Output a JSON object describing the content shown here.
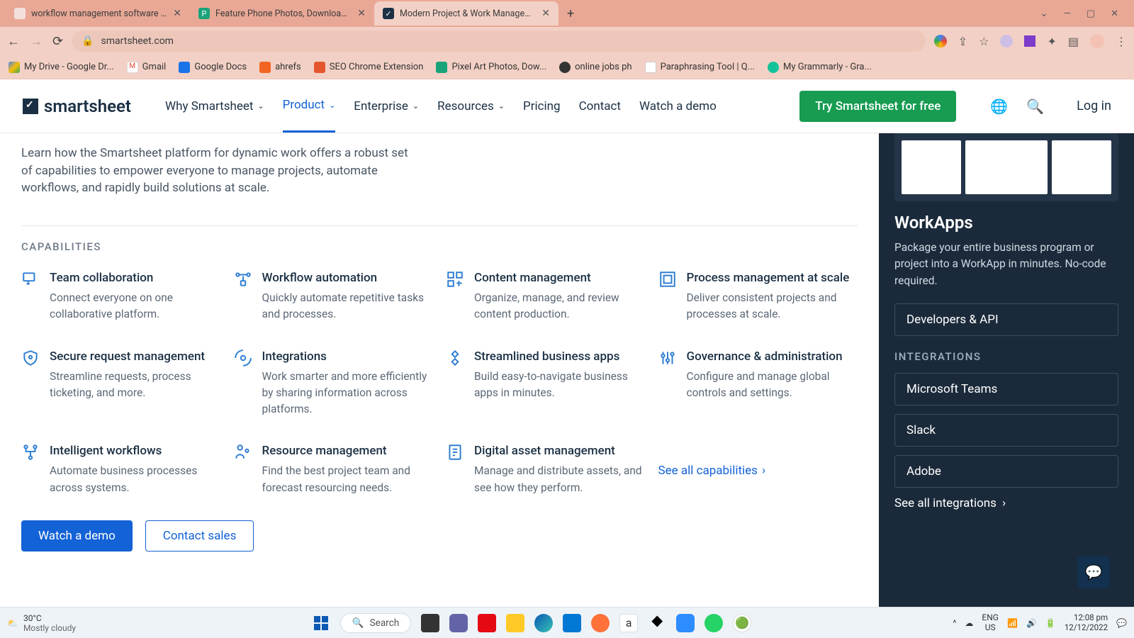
{
  "tabs": [
    {
      "title": "workflow management software - C",
      "active": false,
      "fav": "#dca9a0"
    },
    {
      "title": "Feature Phone Photos, Download Fr",
      "active": false,
      "fav": "#1aa37a"
    },
    {
      "title": "Modern Project & Work Manageme",
      "active": true,
      "fav": "#1b3044"
    }
  ],
  "address": {
    "url": "smartsheet.com"
  },
  "bookmarks": [
    {
      "label": "My Drive - Google Dr...",
      "color": "#f4b400"
    },
    {
      "label": "Gmail",
      "color": "#ea4335"
    },
    {
      "label": "Google Docs",
      "color": "#1a73e8"
    },
    {
      "label": "ahrefs",
      "color": "#f26522"
    },
    {
      "label": "SEO Chrome Extension",
      "color": "#e4572e"
    },
    {
      "label": "Pixel Art Photos, Dow...",
      "color": "#1aa37a"
    },
    {
      "label": "online jobs ph",
      "color": "#333"
    },
    {
      "label": "Paraphrasing Tool | Q...",
      "color": "#555"
    },
    {
      "label": "My Grammarly - Gra...",
      "color": "#15c39a"
    }
  ],
  "header": {
    "logo": "smartsheet",
    "nav": [
      {
        "label": "Why Smartsheet",
        "dropdown": true
      },
      {
        "label": "Product",
        "dropdown": true,
        "active": true
      },
      {
        "label": "Enterprise",
        "dropdown": true
      },
      {
        "label": "Resources",
        "dropdown": true
      },
      {
        "label": "Pricing",
        "dropdown": false
      },
      {
        "label": "Contact",
        "dropdown": false
      },
      {
        "label": "Watch a demo",
        "dropdown": false
      }
    ],
    "cta": "Try Smartsheet for free",
    "login": "Log in"
  },
  "intro": "Learn how the Smartsheet platform for dynamic work offers a robust set of capabilities to empower everyone to manage projects, automate workflows, and rapidly build solutions at scale.",
  "caps_label": "CAPABILITIES",
  "caps": [
    {
      "title": "Team collaboration",
      "desc": "Connect everyone on one collaborative platform."
    },
    {
      "title": "Workflow automation",
      "desc": "Quickly automate repetitive tasks and processes."
    },
    {
      "title": "Content management",
      "desc": "Organize, manage, and review content production."
    },
    {
      "title": "Process management at scale",
      "desc": "Deliver consistent projects and processes at scale."
    },
    {
      "title": "Secure request management",
      "desc": "Streamline requests, process ticketing, and more."
    },
    {
      "title": "Integrations",
      "desc": "Work smarter and more efficiently by sharing information across platforms."
    },
    {
      "title": "Streamlined business apps",
      "desc": "Build easy-to-navigate business apps in minutes."
    },
    {
      "title": "Governance & administration",
      "desc": "Configure and manage global controls and settings."
    },
    {
      "title": "Intelligent workflows",
      "desc": "Automate business processes across systems."
    },
    {
      "title": "Resource management",
      "desc": "Find the best project team and forecast resourcing needs."
    },
    {
      "title": "Digital asset management",
      "desc": "Manage and distribute assets, and see how they perform."
    }
  ],
  "see_all_caps": "See all capabilities",
  "buttons": {
    "demo": "Watch a demo",
    "contact": "Contact sales"
  },
  "side": {
    "title": "WorkApps",
    "desc": "Package your entire business program or project into a WorkApp in minutes. No-code required.",
    "dev": "Developers & API",
    "int_label": "INTEGRATIONS",
    "ints": [
      "Microsoft Teams",
      "Slack",
      "Adobe"
    ],
    "see_all": "See all integrations"
  },
  "taskbar": {
    "temp": "30°C",
    "weather": "Mostly cloudy",
    "search": "Search",
    "lang1": "ENG",
    "lang2": "US",
    "time": "12:08 pm",
    "date": "12/12/2022"
  }
}
